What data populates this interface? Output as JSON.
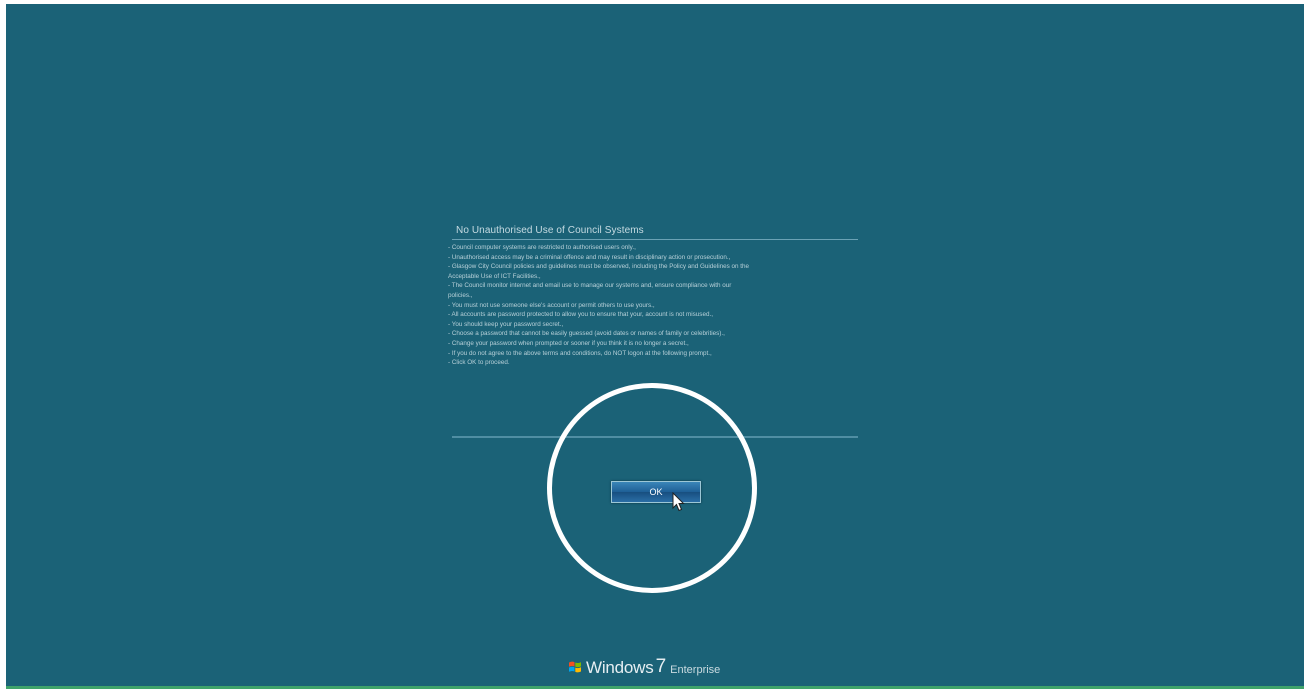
{
  "notice": {
    "title": "No Unauthorised Use of Council Systems",
    "lines": [
      "- Council computer systems are restricted to authorised users only.,",
      "- Unauthorised access may be a criminal offence and may result in disciplinary action or prosecution.,",
      "- Glasgow City Council policies and guidelines must be observed, including the Policy and Guidelines on the",
      "Acceptable Use of ICT Facilities.,",
      "- The Council monitor internet and email use to manage our systems and, ensure compliance with our",
      "policies.,",
      "- You must not use someone else's account or permit others to use yours.,",
      "- All accounts are password protected to allow you to ensure that your, account is not misused.,",
      "- You should keep your password secret.,",
      "- Choose a password that cannot be easily guessed (avoid dates or names of family or celebrities).,",
      "- Change your password when prompted or sooner if you think it is no longer a secret.,",
      "- If you do not agree to the above terms and conditions, do NOT logon at the following prompt.,",
      "- Click OK to proceed."
    ]
  },
  "ok_button": {
    "label": "OK"
  },
  "brand": {
    "name": "Windows",
    "version": "7",
    "edition": "Enterprise"
  },
  "colors": {
    "background": "#1b6277",
    "highlight_circle": "#ffffff"
  },
  "icons": {
    "logo": "windows-flag-icon",
    "cursor": "mouse-pointer-icon"
  }
}
